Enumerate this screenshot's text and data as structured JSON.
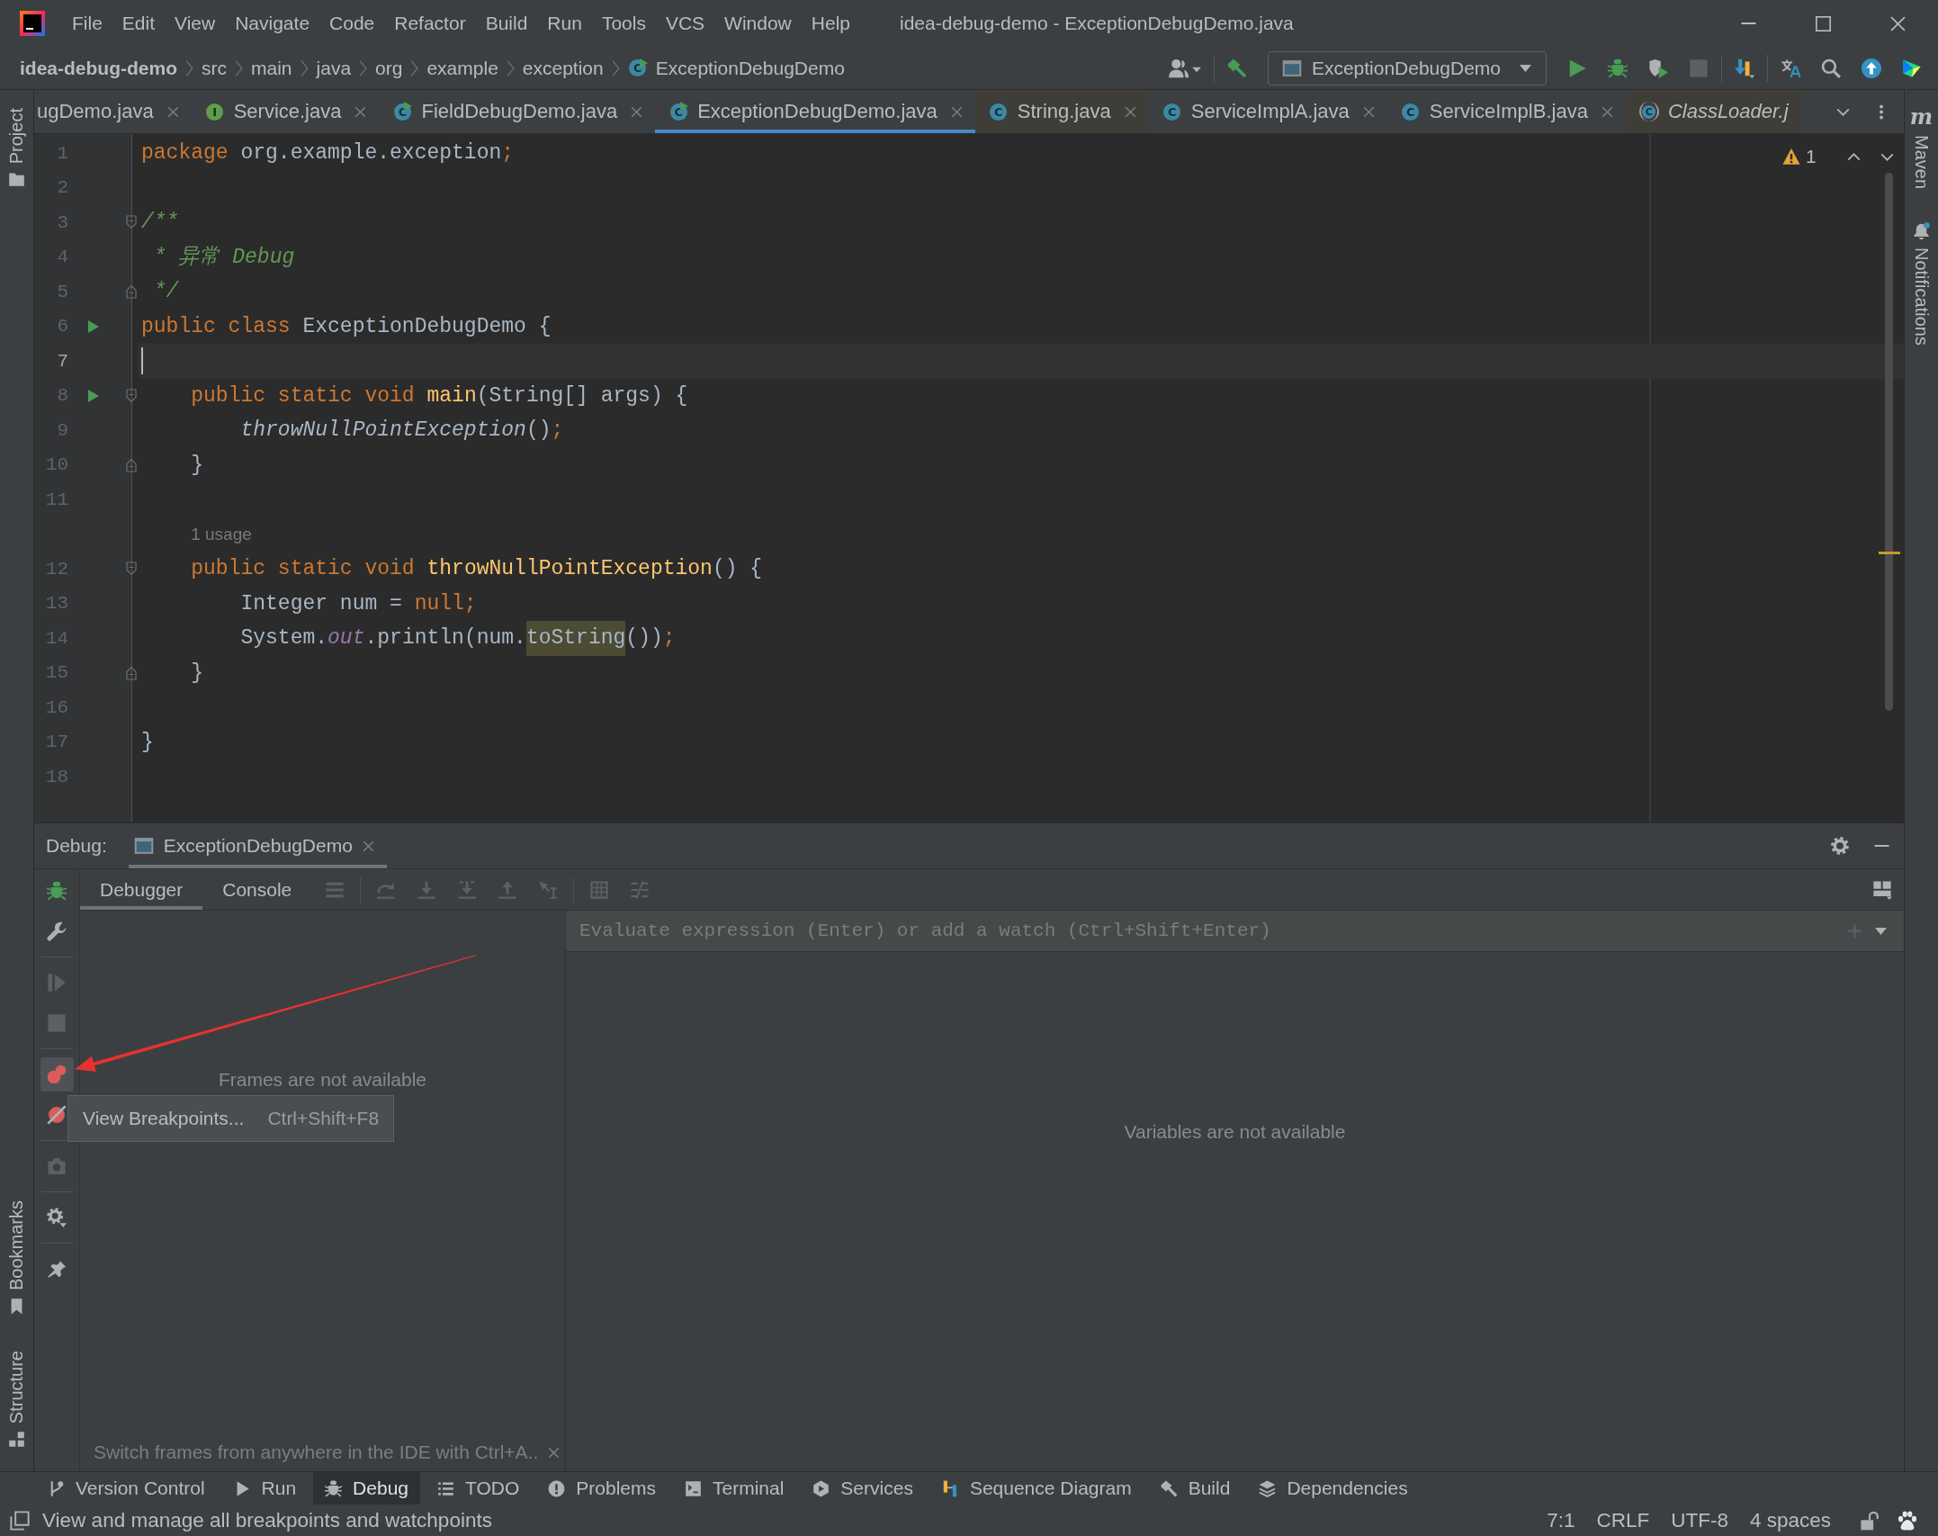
{
  "window": {
    "title": "idea-debug-demo - ExceptionDebugDemo.java"
  },
  "menu": [
    "File",
    "Edit",
    "View",
    "Navigate",
    "Code",
    "Refactor",
    "Build",
    "Run",
    "Tools",
    "VCS",
    "Window",
    "Help"
  ],
  "breadcrumb": [
    {
      "label": "idea-debug-demo",
      "kind": "project"
    },
    {
      "label": "src",
      "kind": "folder"
    },
    {
      "label": "main",
      "kind": "folder"
    },
    {
      "label": "java",
      "kind": "folder"
    },
    {
      "label": "org",
      "kind": "folder"
    },
    {
      "label": "example",
      "kind": "folder"
    },
    {
      "label": "exception",
      "kind": "folder"
    },
    {
      "label": "ExceptionDebugDemo",
      "kind": "runnable-class",
      "icon_letter": "C"
    }
  ],
  "toolbar": [
    [
      {
        "kind": "user",
        "disabled": false
      }
    ],
    [
      {
        "kind": "build",
        "disabled": false
      },
      {
        "kind": "run-config",
        "label": "ExceptionDebugDemo"
      },
      {
        "kind": "run",
        "disabled": false
      },
      {
        "kind": "debug",
        "disabled": false
      },
      {
        "kind": "coverage",
        "disabled": false
      },
      {
        "kind": "stop",
        "disabled": true
      }
    ],
    [
      {
        "kind": "vcs-update",
        "disabled": false
      }
    ],
    [
      {
        "kind": "translate",
        "disabled": false
      },
      {
        "kind": "search",
        "disabled": false
      },
      {
        "kind": "update",
        "disabled": false
      },
      {
        "kind": "toolbox",
        "disabled": false
      }
    ]
  ],
  "left_stripe": {
    "top": [
      {
        "label": "Project",
        "kind": "project"
      }
    ],
    "bottom": [
      {
        "label": "Bookmarks",
        "kind": "bookmarks"
      },
      {
        "label": "Structure",
        "kind": "structure"
      }
    ]
  },
  "right_stripe": [
    {
      "label": "Maven",
      "kind": "maven",
      "icon_letter": "m"
    },
    {
      "label": "Notifications",
      "kind": "notifications"
    }
  ],
  "editor_tabs": [
    {
      "label": "ugDemo.java",
      "kind": "plain",
      "selected": false,
      "preview": false,
      "closable": true
    },
    {
      "label": "Service.java",
      "kind": "interface",
      "icon_letter": "I",
      "selected": false,
      "preview": false,
      "closable": true
    },
    {
      "label": "FieldDebugDemo.java",
      "kind": "runnable-class",
      "icon_letter": "C",
      "selected": false,
      "preview": false,
      "closable": true
    },
    {
      "label": "ExceptionDebugDemo.java",
      "kind": "runnable-class",
      "icon_letter": "C",
      "selected": true,
      "preview": false,
      "closable": true
    },
    {
      "label": "String.java",
      "kind": "library-class",
      "icon_letter": "C",
      "selected": false,
      "preview": false,
      "closable": true
    },
    {
      "label": "ServiceImplA.java",
      "kind": "class",
      "icon_letter": "C",
      "selected": false,
      "preview": false,
      "closable": true
    },
    {
      "label": "ServiceImplB.java",
      "kind": "class",
      "icon_letter": "C",
      "selected": false,
      "preview": false,
      "closable": true
    },
    {
      "label": "ClassLoader.j",
      "kind": "compiled-class",
      "icon_letter": "C",
      "selected": false,
      "preview": true,
      "closable": false
    }
  ],
  "editor": {
    "inspection": {
      "warnings": "1"
    },
    "lines": [
      {
        "kind": "code",
        "number": "1",
        "current": false,
        "run": false,
        "fold_start": false,
        "fold_end": false,
        "tokens": [
          {
            "kind": "keyword",
            "text": "package"
          },
          {
            "kind": "plain",
            "text": " org.example.exception"
          },
          {
            "kind": "keyword",
            "text": ";"
          }
        ]
      },
      {
        "kind": "code",
        "number": "2",
        "current": false,
        "run": false,
        "fold_start": false,
        "fold_end": false
      },
      {
        "kind": "code",
        "number": "3",
        "current": false,
        "run": false,
        "fold_start": true,
        "fold_end": false,
        "tokens": [
          {
            "kind": "doc",
            "text": "/**"
          }
        ]
      },
      {
        "kind": "code",
        "number": "4",
        "current": false,
        "run": false,
        "fold_start": false,
        "fold_end": false,
        "tokens": [
          {
            "kind": "doc",
            "text": " * 异常 Debug"
          }
        ]
      },
      {
        "kind": "code",
        "number": "5",
        "current": false,
        "run": false,
        "fold_start": false,
        "fold_end": true,
        "tokens": [
          {
            "kind": "doc",
            "text": " */"
          }
        ]
      },
      {
        "kind": "code",
        "number": "6",
        "current": false,
        "run": true,
        "fold_start": false,
        "fold_end": false,
        "tokens": [
          {
            "kind": "keyword",
            "text": "public class"
          },
          {
            "kind": "plain",
            "text": " ExceptionDebugDemo {"
          }
        ]
      },
      {
        "kind": "code",
        "number": "7",
        "current": true,
        "run": false,
        "fold_start": false,
        "fold_end": false
      },
      {
        "kind": "code",
        "number": "8",
        "current": false,
        "run": true,
        "fold_start": true,
        "fold_end": false,
        "tokens": [
          {
            "kind": "keyword",
            "text": "    public static void "
          },
          {
            "kind": "declaration",
            "text": "main"
          },
          {
            "kind": "plain",
            "text": "(String[] args) {"
          }
        ]
      },
      {
        "kind": "code",
        "number": "9",
        "current": false,
        "run": false,
        "fold_start": false,
        "fold_end": false,
        "tokens": [
          {
            "kind": "static-call",
            "text": "        throwNullPointException"
          },
          {
            "kind": "plain",
            "text": "()"
          },
          {
            "kind": "keyword",
            "text": ";"
          }
        ]
      },
      {
        "kind": "code",
        "number": "10",
        "current": false,
        "run": false,
        "fold_start": false,
        "fold_end": true,
        "tokens": [
          {
            "kind": "plain",
            "text": "    }"
          }
        ]
      },
      {
        "kind": "code",
        "number": "11",
        "current": false,
        "run": false,
        "fold_start": false,
        "fold_end": false
      },
      {
        "kind": "inlay",
        "text": "1 usage"
      },
      {
        "kind": "code",
        "number": "12",
        "current": false,
        "run": false,
        "fold_start": true,
        "fold_end": false,
        "tokens": [
          {
            "kind": "keyword",
            "text": "    public static void "
          },
          {
            "kind": "declaration",
            "text": "throwNullPointException"
          },
          {
            "kind": "plain",
            "text": "() {"
          }
        ]
      },
      {
        "kind": "code",
        "number": "13",
        "current": false,
        "run": false,
        "fold_start": false,
        "fold_end": false,
        "tokens": [
          {
            "kind": "plain",
            "text": "        Integer num = "
          },
          {
            "kind": "keyword",
            "text": "null;"
          }
        ]
      },
      {
        "kind": "code",
        "number": "14",
        "current": false,
        "run": false,
        "fold_start": false,
        "fold_end": false,
        "tokens": [
          {
            "kind": "plain",
            "text": "        System."
          },
          {
            "kind": "static-field",
            "text": "out"
          },
          {
            "kind": "plain",
            "text": ".println(num."
          },
          {
            "kind": "usage-highlight",
            "text": "toString"
          },
          {
            "kind": "plain",
            "text": "())"
          },
          {
            "kind": "keyword",
            "text": ";"
          }
        ]
      },
      {
        "kind": "code",
        "number": "15",
        "current": false,
        "run": false,
        "fold_start": false,
        "fold_end": true,
        "tokens": [
          {
            "kind": "plain",
            "text": "    }"
          }
        ]
      },
      {
        "kind": "code",
        "number": "16",
        "current": false,
        "run": false,
        "fold_start": false,
        "fold_end": false
      },
      {
        "kind": "code",
        "number": "17",
        "current": false,
        "run": false,
        "fold_start": false,
        "fold_end": false,
        "tokens": [
          {
            "kind": "plain",
            "text": "}"
          }
        ]
      },
      {
        "kind": "code",
        "number": "18",
        "current": false,
        "run": false,
        "fold_start": false,
        "fold_end": false
      }
    ]
  },
  "debug": {
    "title": "Debug:",
    "sessions": [
      {
        "label": "ExceptionDebugDemo",
        "selected": true
      }
    ],
    "side_toolbar": [
      [
        {
          "kind": "debug",
          "disabled": false,
          "hovered": false
        },
        {
          "kind": "wrench",
          "disabled": false,
          "hovered": false
        }
      ],
      [
        {
          "kind": "resume",
          "disabled": true,
          "hovered": false
        },
        {
          "kind": "stop",
          "disabled": true,
          "hovered": false
        }
      ],
      [
        {
          "kind": "view-breakpoints",
          "disabled": false,
          "hovered": true
        },
        {
          "kind": "mute-breakpoints",
          "disabled": false,
          "hovered": false
        }
      ],
      [
        {
          "kind": "snapshot",
          "disabled": true,
          "hovered": false
        }
      ],
      [
        {
          "kind": "settings",
          "disabled": false,
          "hovered": false
        }
      ],
      [
        {
          "kind": "pin",
          "disabled": false,
          "hovered": false
        }
      ]
    ],
    "tabs": [
      {
        "label": "Debugger",
        "selected": true
      },
      {
        "label": "Console",
        "selected": false
      }
    ],
    "step_toolbar": [
      [
        {
          "kind": "frames-list",
          "disabled": true
        }
      ],
      [
        {
          "kind": "step-over",
          "disabled": true
        },
        {
          "kind": "step-into",
          "disabled": true
        },
        {
          "kind": "force-step-into",
          "disabled": true
        },
        {
          "kind": "step-out",
          "disabled": true
        },
        {
          "kind": "run-to-cursor",
          "disabled": true
        }
      ],
      [
        {
          "kind": "evaluate",
          "disabled": true
        },
        {
          "kind": "trace",
          "disabled": true
        }
      ]
    ],
    "frames": {
      "empty_text": "Frames are not available",
      "hint": "Switch frames from anywhere in the IDE with Ctrl+A.."
    },
    "variables": {
      "placeholder": "Evaluate expression (Enter) or add a watch (Ctrl+Shift+Enter)",
      "empty_text": "Variables are not available"
    },
    "tooltip": {
      "label": "View Breakpoints...",
      "shortcut": "Ctrl+Shift+F8"
    }
  },
  "tool_windows": [
    {
      "label": "Version Control",
      "kind": "version-control",
      "selected": false
    },
    {
      "label": "Run",
      "kind": "run",
      "selected": false
    },
    {
      "label": "Debug",
      "kind": "debug",
      "selected": true
    },
    {
      "label": "TODO",
      "kind": "todo",
      "selected": false
    },
    {
      "label": "Problems",
      "kind": "problems",
      "selected": false
    },
    {
      "label": "Terminal",
      "kind": "terminal",
      "selected": false
    },
    {
      "label": "Services",
      "kind": "services",
      "selected": false
    },
    {
      "label": "Sequence Diagram",
      "kind": "sequence-diagram",
      "selected": false
    },
    {
      "label": "Build",
      "kind": "build",
      "selected": false
    },
    {
      "label": "Dependencies",
      "kind": "dependencies",
      "selected": false
    }
  ],
  "status_bar": {
    "message": "View and manage all breakpoints and watchpoints",
    "items": [
      "7:1",
      "CRLF",
      "UTF-8",
      "4 spaces"
    ]
  }
}
